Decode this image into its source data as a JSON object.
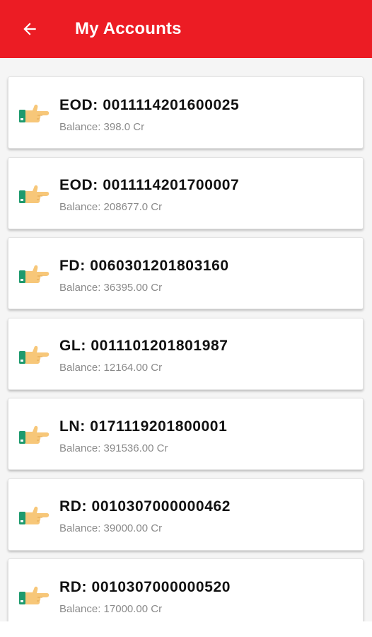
{
  "appbar": {
    "title": "My Accounts",
    "color": "#ec1c24",
    "back_icon": "arrow-left-icon"
  },
  "accounts": [
    {
      "label": "EOD: 0011114201600025",
      "balance": "Balance: 398.0 Cr"
    },
    {
      "label": "EOD: 0011114201700007",
      "balance": "Balance: 208677.0 Cr"
    },
    {
      "label": "FD: 0060301201803160",
      "balance": "Balance: 36395.00 Cr"
    },
    {
      "label": "GL: 0011101201801987",
      "balance": "Balance: 12164.00 Cr"
    },
    {
      "label": "LN: 0171119201800001",
      "balance": "Balance: 391536.00 Cr"
    },
    {
      "label": "RD: 0010307000000462",
      "balance": "Balance: 39000.00 Cr"
    },
    {
      "label": "RD: 0010307000000520",
      "balance": "Balance: 17000.00 Cr"
    }
  ],
  "item_icon": "pointing-hand-icon"
}
